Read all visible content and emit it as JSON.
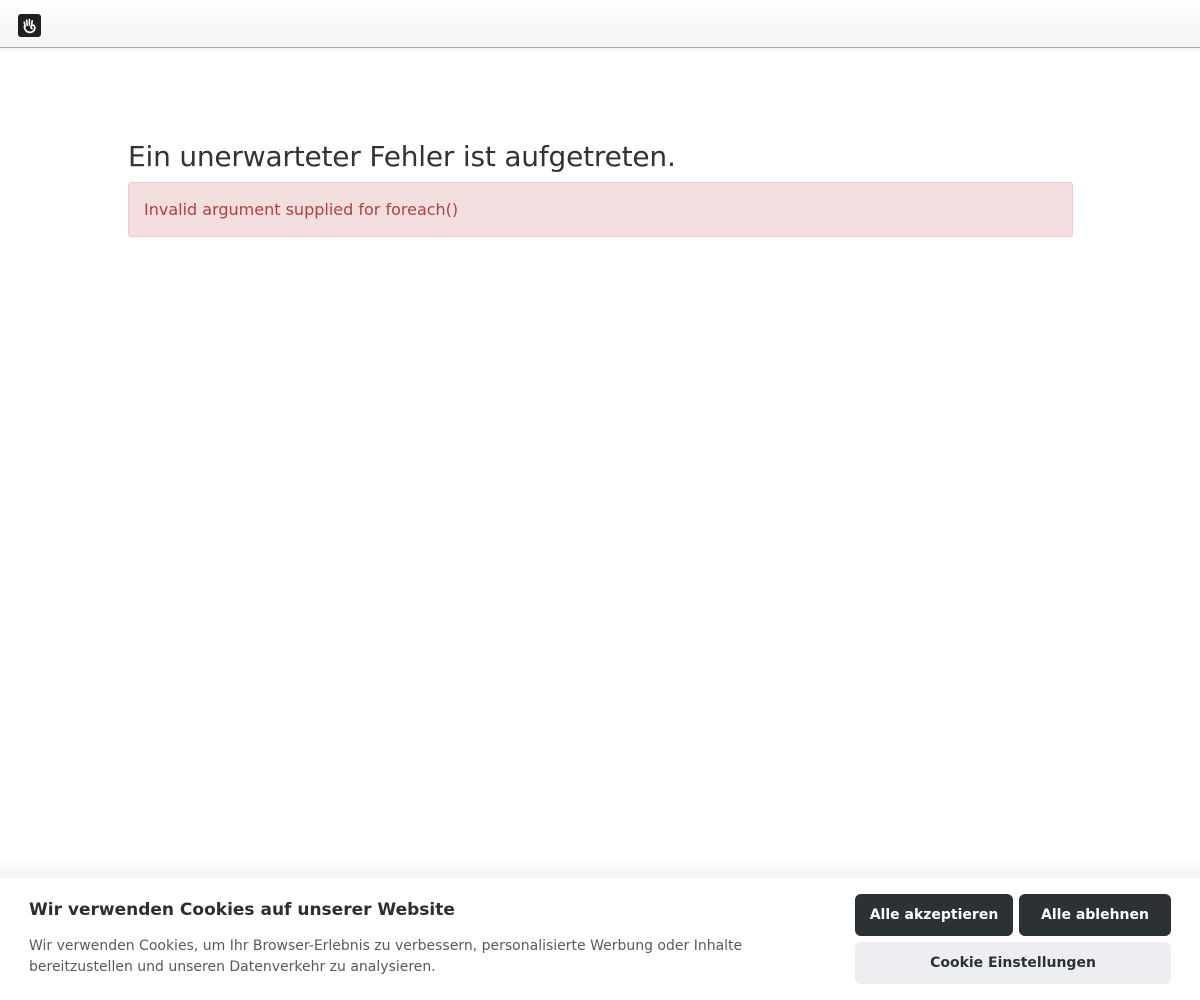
{
  "toolbar": {
    "logo_icon": "concrete-hand-logo-icon"
  },
  "main": {
    "title": "Ein unerwarteter Fehler ist aufgetreten.",
    "error_message": "Invalid argument supplied for foreach()"
  },
  "cookie_banner": {
    "title": "Wir verwenden Cookies auf unserer Website",
    "text": "Wir verwenden Cookies, um Ihr Browser-Erlebnis zu verbessern, personalisierte Werbung oder Inhalte bereitzustellen und unseren Datenverkehr zu analysieren.",
    "accept_all_label": "Alle akzeptieren",
    "reject_all_label": "Alle ablehnen",
    "settings_label": "Cookie Einstellungen"
  },
  "colors": {
    "alert_background": "#f2dede",
    "alert_text": "#a94442",
    "button_dark": "#2c3136",
    "button_light": "#eceef1"
  }
}
